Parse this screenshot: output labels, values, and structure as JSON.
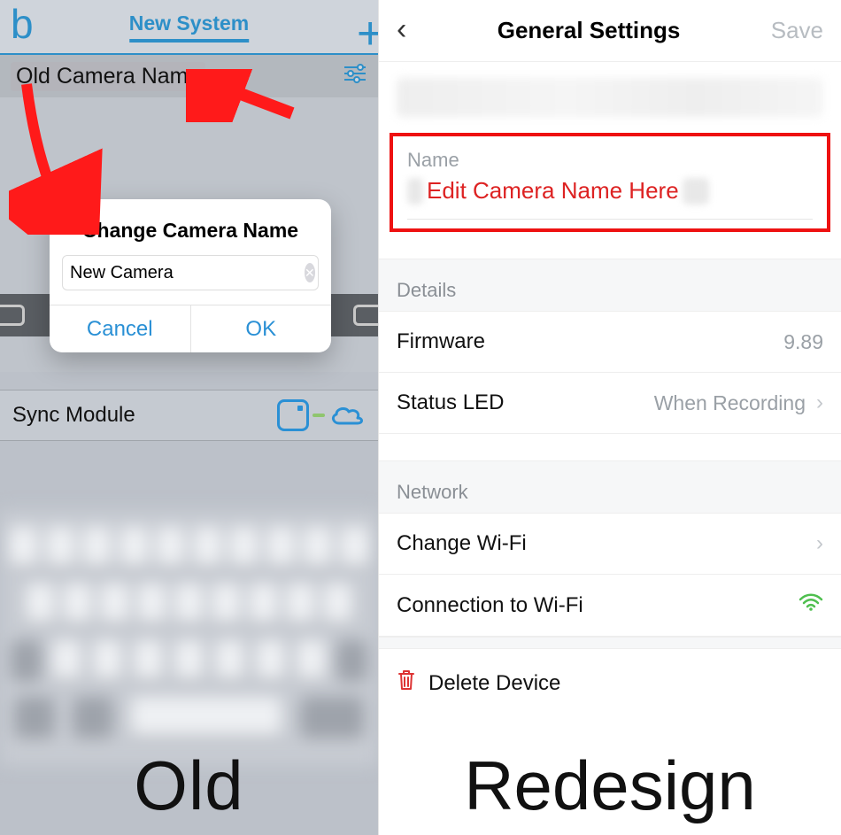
{
  "left": {
    "logo": "b",
    "header_tab": "New System",
    "camera_name": "Old Camera Name",
    "dialog": {
      "title": "Change Camera Name",
      "input_value": "New Camera",
      "cancel": "Cancel",
      "ok": "OK"
    },
    "sync_module": "Sync Module",
    "caption": "Old"
  },
  "right": {
    "title": "General Settings",
    "save": "Save",
    "name_section": {
      "label": "Name",
      "value": "Edit Camera Name Here"
    },
    "sections": {
      "details": "Details",
      "network": "Network"
    },
    "rows": {
      "firmware_label": "Firmware",
      "firmware_value": "9.89",
      "status_led_label": "Status LED",
      "status_led_value": "When Recording",
      "change_wifi": "Change Wi-Fi",
      "connection_wifi": "Connection to Wi-Fi",
      "delete_device": "Delete Device"
    },
    "caption": "Redesign"
  }
}
